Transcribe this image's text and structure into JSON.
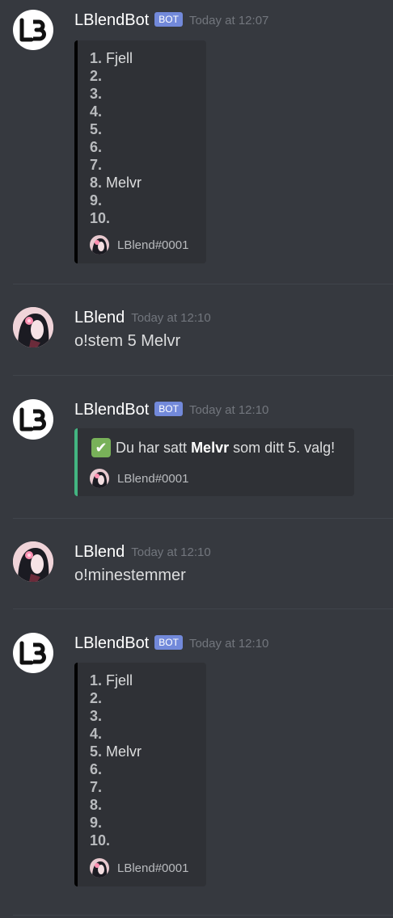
{
  "messages": {
    "m1": {
      "username": "LBlendBot",
      "bot_tag": "BOT",
      "timestamp": "Today at 12:07",
      "embed_rows": [
        {
          "num": "1.",
          "text": "Fjell"
        },
        {
          "num": "2.",
          "text": ""
        },
        {
          "num": "3.",
          "text": ""
        },
        {
          "num": "4.",
          "text": ""
        },
        {
          "num": "5.",
          "text": ""
        },
        {
          "num": "6.",
          "text": ""
        },
        {
          "num": "7.",
          "text": ""
        },
        {
          "num": "8.",
          "text": "Melvr"
        },
        {
          "num": "9.",
          "text": ""
        },
        {
          "num": "10.",
          "text": ""
        }
      ],
      "footer": "LBlend#0001"
    },
    "m2": {
      "username": "LBlend",
      "timestamp": "Today at 12:10",
      "content": "o!stem 5 Melvr"
    },
    "m3": {
      "username": "LBlendBot",
      "bot_tag": "BOT",
      "timestamp": "Today at 12:10",
      "desc_pre": "Du har satt",
      "desc_bold": "Melvr",
      "desc_post": "som ditt 5. valg!",
      "footer": "LBlend#0001"
    },
    "m4": {
      "username": "LBlend",
      "timestamp": "Today at 12:10",
      "content": "o!minestemmer"
    },
    "m5": {
      "username": "LBlendBot",
      "bot_tag": "BOT",
      "timestamp": "Today at 12:10",
      "embed_rows": [
        {
          "num": "1.",
          "text": "Fjell"
        },
        {
          "num": "2.",
          "text": ""
        },
        {
          "num": "3.",
          "text": ""
        },
        {
          "num": "4.",
          "text": ""
        },
        {
          "num": "5.",
          "text": "Melvr"
        },
        {
          "num": "6.",
          "text": ""
        },
        {
          "num": "7.",
          "text": ""
        },
        {
          "num": "8.",
          "text": ""
        },
        {
          "num": "9.",
          "text": ""
        },
        {
          "num": "10.",
          "text": ""
        }
      ],
      "footer": "LBlend#0001"
    }
  },
  "colors": {
    "background": "#36393f",
    "embed_background": "#2f3136",
    "bot_tag": "#7289da",
    "success_accent": "#43b581",
    "check_emoji": "#78b159"
  },
  "icons": {
    "bot_avatar": "lb-logo-icon",
    "user_avatar": "anime-girl-avatar-icon",
    "check": "white-check-mark-icon"
  }
}
